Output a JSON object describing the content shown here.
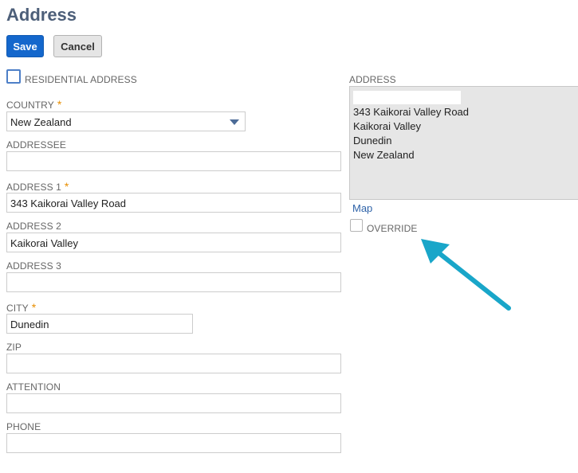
{
  "page": {
    "title": "Address"
  },
  "buttons": {
    "save": "Save",
    "cancel": "Cancel"
  },
  "form": {
    "residential_label": "RESIDENTIAL ADDRESS",
    "country_label": "COUNTRY",
    "country_value": "New Zealand",
    "addressee_label": "ADDRESSEE",
    "addressee_value": "",
    "address1_label": "ADDRESS 1",
    "address1_value": "343 Kaikorai Valley Road",
    "address2_label": "ADDRESS 2",
    "address2_value": "Kaikorai Valley",
    "address3_label": "ADDRESS 3",
    "address3_value": "",
    "city_label": "CITY",
    "city_value": "Dunedin",
    "zip_label": "ZIP",
    "zip_value": "",
    "attention_label": "ATTENTION",
    "attention_value": "",
    "phone_label": "PHONE",
    "phone_value": "",
    "required_mark": "*"
  },
  "preview": {
    "label": "ADDRESS",
    "lines": [
      "343 Kaikorai Valley Road",
      "Kaikorai Valley",
      "Dunedin",
      "New Zealand"
    ],
    "map_link": "Map",
    "override_label": "OVERRIDE"
  },
  "colors": {
    "primary": "#1467cc",
    "required": "#e88e00",
    "annotation_arrow": "#19a6c9",
    "title": "#4d5f79"
  }
}
